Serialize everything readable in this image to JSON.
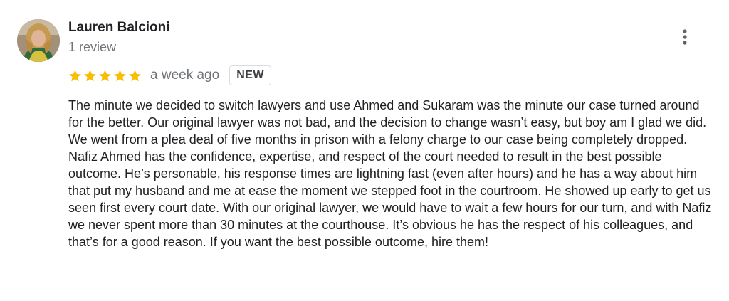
{
  "review": {
    "author_name": "Lauren Balcioni",
    "review_count": "1 review",
    "rating": 5,
    "rating_max": 5,
    "star_color": "#fbbc04",
    "date": "a week ago",
    "badge": "NEW",
    "text": "The minute we decided to switch lawyers and use Ahmed and Sukaram was the minute our case turned around for the better. Our original lawyer was not bad, and the decision to change wasn’t easy, but boy am I glad we did. We went from a plea deal of five months in prison with a felony charge to our case being completely dropped. Nafiz Ahmed has the confidence, expertise, and respect of the court needed to result in the best possible outcome. He’s personable, his response times are lightning fast (even after hours) and he has a way about him that put my husband and me at ease the moment we stepped foot in the courtroom. He showed up early to get us seen first every court date. With our original lawyer, we would have to wait a few hours for our turn, and with Nafiz we never spent more than 30 minutes at the courthouse. It’s obvious he has the respect of his colleagues, and that’s for a good reason. If you want the best possible outcome, hire them!"
  },
  "icons": {
    "menu": "more-vert-icon",
    "star": "star-icon"
  }
}
